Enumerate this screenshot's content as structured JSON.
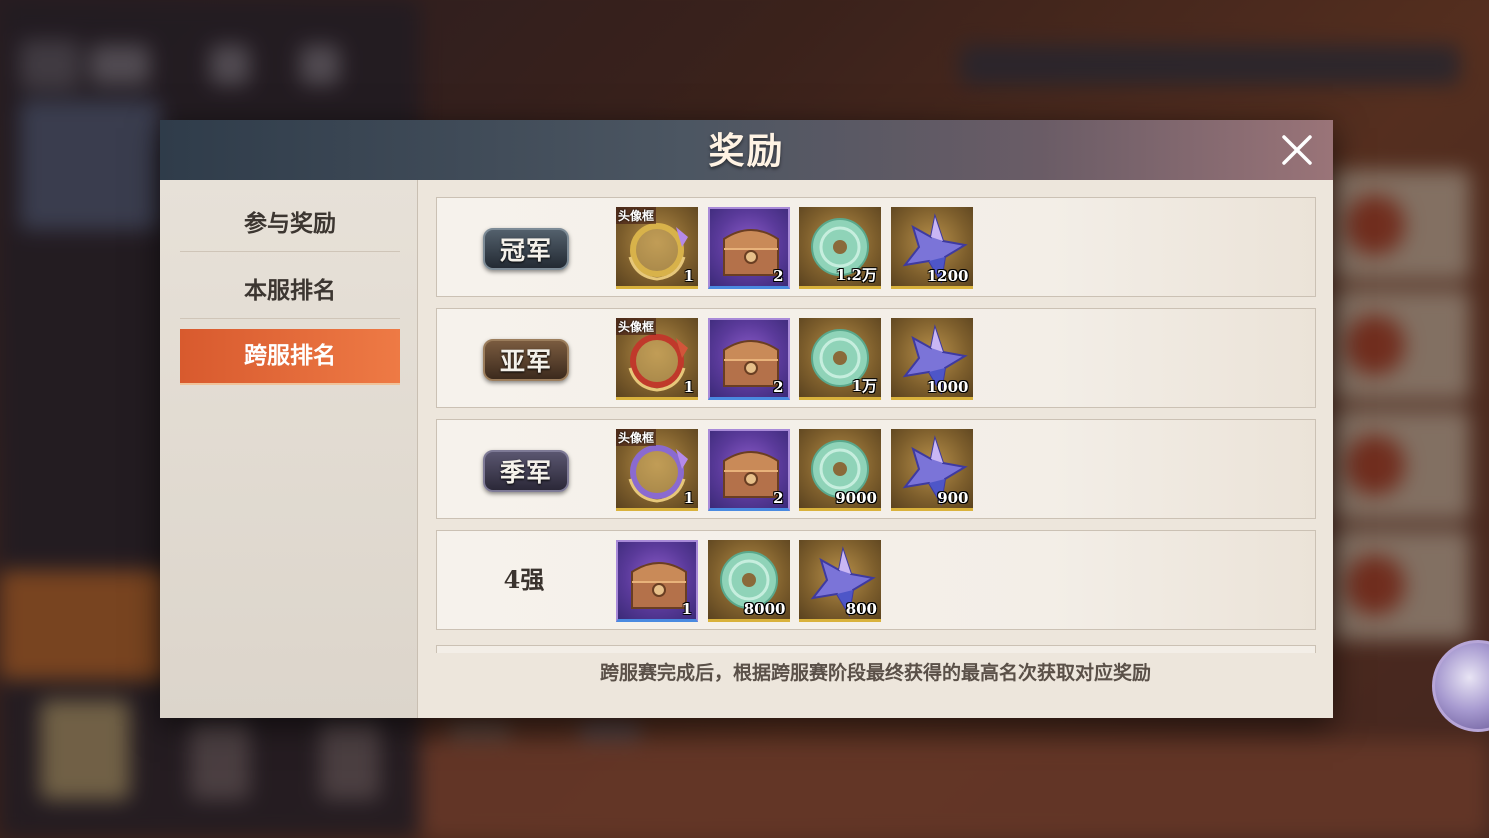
{
  "modal": {
    "title": "奖励"
  },
  "sidebar": {
    "items": [
      {
        "label": "参与奖励",
        "active": false
      },
      {
        "label": "本服排名",
        "active": false
      },
      {
        "label": "跨服排名",
        "active": true
      }
    ]
  },
  "rows": [
    {
      "rank": "冠军",
      "items": [
        {
          "icon": "avatar-frame-icon",
          "tag": "头像框",
          "qty": "1"
        },
        {
          "icon": "treasure-chest-icon",
          "qty": "2"
        },
        {
          "icon": "jade-coin-icon",
          "qty": "1.2万"
        },
        {
          "icon": "star-crystal-icon",
          "qty": "1200"
        }
      ]
    },
    {
      "rank": "亚军",
      "items": [
        {
          "icon": "avatar-frame-icon",
          "tag": "头像框",
          "qty": "1"
        },
        {
          "icon": "treasure-chest-icon",
          "qty": "2"
        },
        {
          "icon": "jade-coin-icon",
          "qty": "1万"
        },
        {
          "icon": "star-crystal-icon",
          "qty": "1000"
        }
      ]
    },
    {
      "rank": "季军",
      "items": [
        {
          "icon": "avatar-frame-icon",
          "tag": "头像框",
          "qty": "1"
        },
        {
          "icon": "treasure-chest-icon",
          "qty": "2"
        },
        {
          "icon": "jade-coin-icon",
          "qty": "9000"
        },
        {
          "icon": "star-crystal-icon",
          "qty": "900"
        }
      ]
    },
    {
      "rank": "4强",
      "items": [
        {
          "icon": "treasure-chest-icon",
          "qty": "1"
        },
        {
          "icon": "jade-coin-icon",
          "qty": "8000"
        },
        {
          "icon": "star-crystal-icon",
          "qty": "800"
        }
      ]
    }
  ],
  "footer_note": "跨服赛完成后，根据跨服赛阶段最终获得的最高名次获取对应奖励",
  "colors": {
    "accent": "#e06a38",
    "header_start": "#2f3c4a",
    "header_end": "#9a7478",
    "panel_bg": "#ede6dc"
  }
}
